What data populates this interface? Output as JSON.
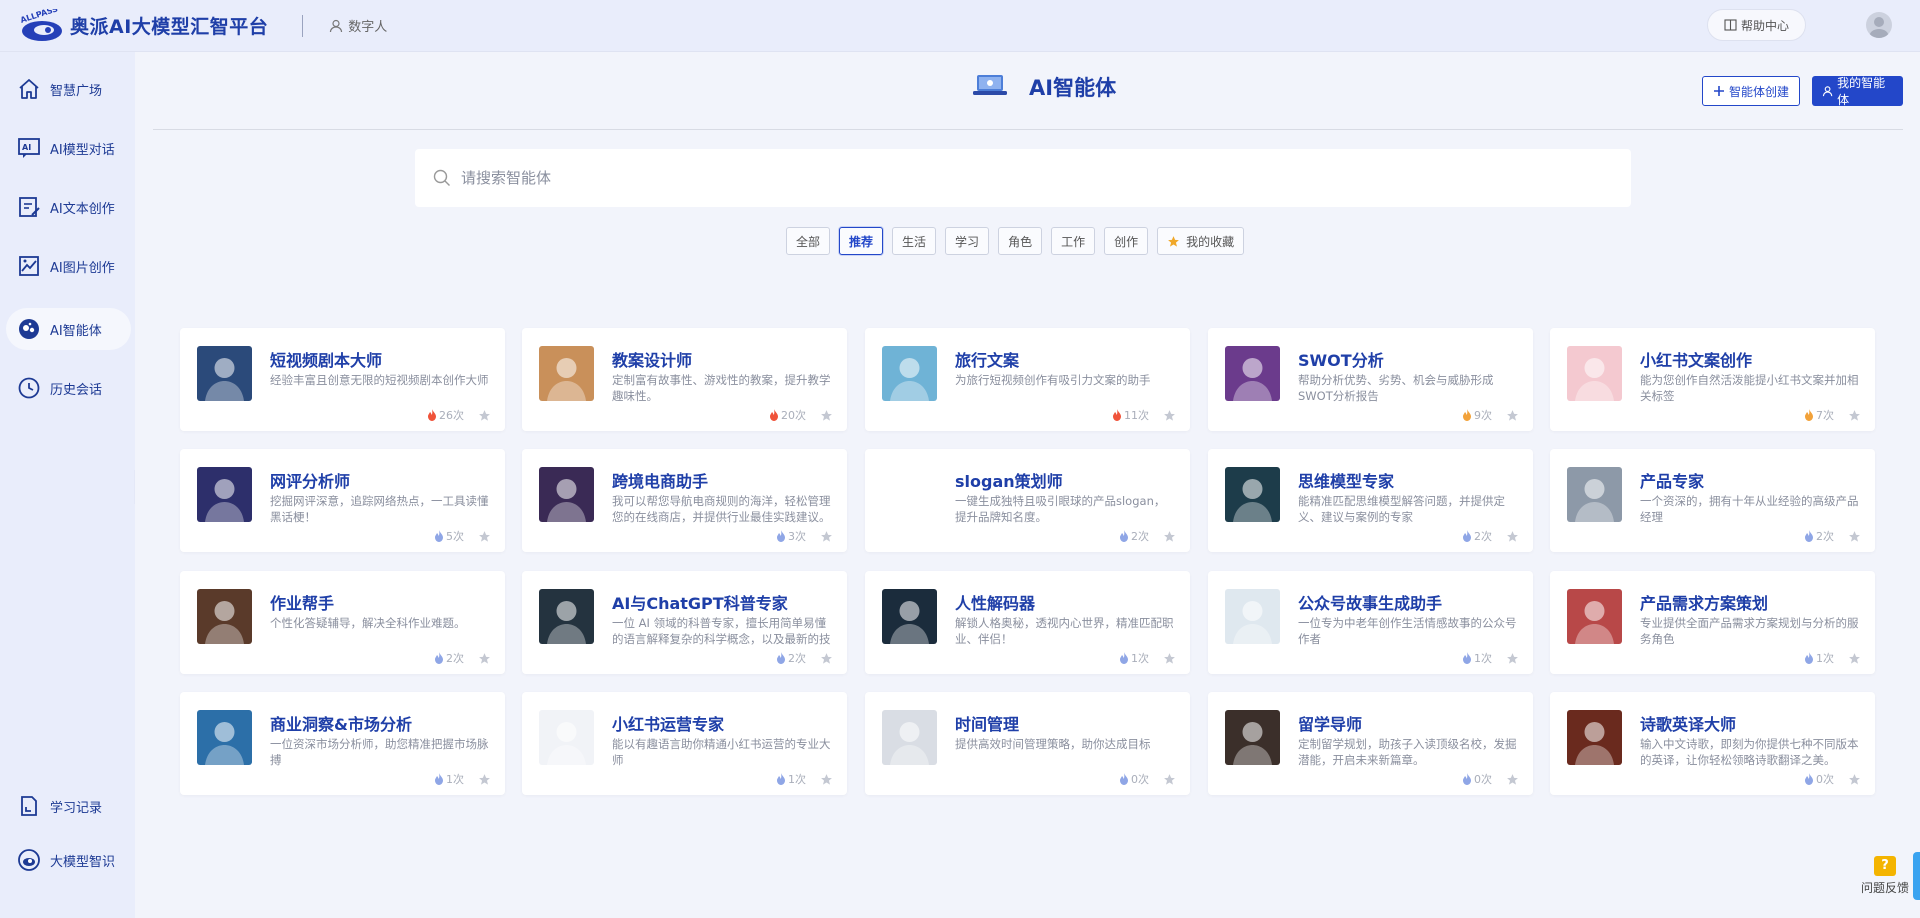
{
  "app": {
    "title": "奥派AI大模型汇智平台",
    "logo_text": "ALLPASS"
  },
  "topbar": {
    "digital_human": "数字人",
    "help": "帮助中心"
  },
  "sidebar": {
    "items": [
      {
        "label": "智慧广场",
        "icon": "home-icon"
      },
      {
        "label": "AI模型对话",
        "icon": "chat-icon"
      },
      {
        "label": "AI文本创作",
        "icon": "edit-icon"
      },
      {
        "label": "AI图片创作",
        "icon": "image-icon"
      },
      {
        "label": "AI智能体",
        "icon": "agent-icon",
        "active": true
      },
      {
        "label": "历史会话",
        "icon": "clock-icon"
      }
    ],
    "bottom_items": [
      {
        "label": "学习记录",
        "icon": "record-icon"
      },
      {
        "label": "大模型智识",
        "icon": "knowledge-icon"
      }
    ]
  },
  "header": {
    "title": "AI智能体",
    "create_label": "智能体创建",
    "mine_label": "我的智能体"
  },
  "search": {
    "placeholder": "请搜索智能体"
  },
  "filters": {
    "items": [
      "全部",
      "推荐",
      "生活",
      "学习",
      "角色",
      "工作",
      "创作"
    ],
    "active": "推荐",
    "favorites": "我的收藏"
  },
  "cards": [
    {
      "title": "短视频剧本大师",
      "desc": "经验丰富且创意无限的短视频剧本创作大师",
      "count": "26次",
      "hot": true,
      "bg": "#2b4a7a"
    },
    {
      "title": "教案设计师",
      "desc": "定制富有故事性、游戏性的教案，提升教学趣味性。",
      "count": "20次",
      "hot": true,
      "bg": "#c9905a"
    },
    {
      "title": "旅行文案",
      "desc": "为旅行短视频创作有吸引力文案的助手",
      "count": "11次",
      "hot": true,
      "bg": "#6fb3d6"
    },
    {
      "title": "SWOT分析",
      "desc": "帮助分析优势、劣势、机会与威胁形成SWOT分析报告",
      "count": "9次",
      "hot": false,
      "warm": true,
      "bg": "#6b3b8c"
    },
    {
      "title": "小红书文案创作",
      "desc": "能为您创作自然活泼能提小红书文案并加相关标签",
      "count": "7次",
      "hot": false,
      "warm": true,
      "bg": "#f4c9d0"
    },
    {
      "title": "网评分析师",
      "desc": "挖掘网评深意，追踪网络热点，一工具读懂黑话梗！",
      "count": "5次",
      "bg": "#2d2f6b"
    },
    {
      "title": "跨境电商助手",
      "desc": "我可以帮您导航电商规则的海洋，轻松管理您的在线商店，并提供行业最佳实践建议。",
      "count": "3次",
      "bg": "#3a2a55"
    },
    {
      "title": "slogan策划师",
      "desc": "一键生成独特且吸引眼球的产品slogan，提升品牌知名度。",
      "count": "2次",
      "bg": "#ffffff"
    },
    {
      "title": "思维模型专家",
      "desc": "能精准匹配思维模型解答问题，并提供定义、建议与案例的专家",
      "count": "2次",
      "bg": "#1d3c4a"
    },
    {
      "title": "产品专家",
      "desc": "一个资深的，拥有十年从业经验的高级产品经理",
      "count": "2次",
      "bg": "#8d99a8"
    },
    {
      "title": "作业帮手",
      "desc": "个性化答疑辅导，解决全科作业难题。",
      "count": "2次",
      "bg": "#5a3a2a"
    },
    {
      "title": "AI与ChatGPT科普专家",
      "desc": "一位 AI 领域的科普专家，擅长用简单易懂的语言解释复杂的科学概念，以及最新的技术。",
      "count": "2次",
      "bg": "#24333f"
    },
    {
      "title": "人性解码器",
      "desc": "解锁人格奥秘，透视内心世界，精准匹配职业、伴侣！",
      "count": "1次",
      "bg": "#1b2c3c"
    },
    {
      "title": "公众号故事生成助手",
      "desc": "一位专为中老年创作生活情感故事的公众号作者",
      "count": "1次",
      "bg": "#dfe8ef"
    },
    {
      "title": "产品需求方案策划",
      "desc": "专业提供全面产品需求方案规划与分析的服务角色",
      "count": "1次",
      "bg": "#b84848"
    },
    {
      "title": "商业洞察&市场分析",
      "desc": "一位资深市场分析师，助您精准把握市场脉搏",
      "count": "1次",
      "bg": "#2c6fa8"
    },
    {
      "title": "小红书运营专家",
      "desc": "能以有趣语言助你精通小红书运营的专业大师",
      "count": "1次",
      "bg": "#f1f3f7"
    },
    {
      "title": "时间管理",
      "desc": "提供高效时间管理策略，助你达成目标",
      "count": "0次",
      "bg": "#d9dde4"
    },
    {
      "title": "留学导师",
      "desc": "定制留学规划，助孩子入读顶级名校，发掘潜能，开启未来新篇章。",
      "count": "0次",
      "bg": "#3b2f2a"
    },
    {
      "title": "诗歌英译大师",
      "desc": "输入中文诗歌，即刻为你提供七种不同版本的英译，让你轻松领略诗歌翻译之美。",
      "count": "0次",
      "bg": "#6a2a1e"
    }
  ],
  "feedback": {
    "label": "问题反馈",
    "icon_text": "?"
  }
}
